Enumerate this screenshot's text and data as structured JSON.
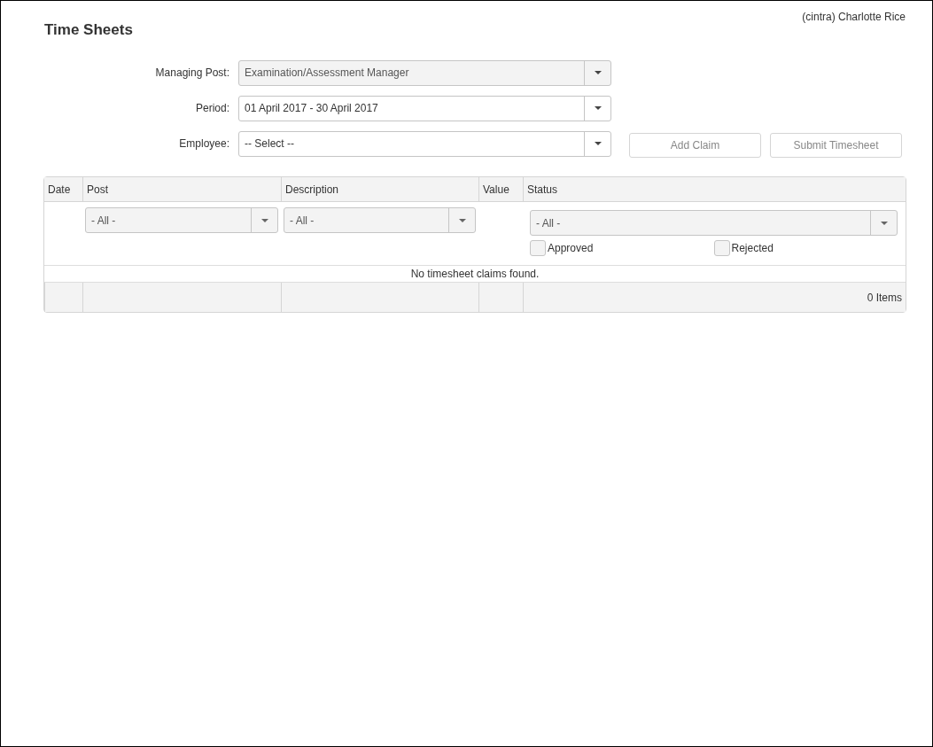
{
  "user": "(cintra) Charlotte Rice",
  "title": "Time Sheets",
  "form": [
    {
      "label": "Managing Post:",
      "value": "Examination/Assessment Manager",
      "disabled": true
    },
    {
      "label": "Period:",
      "value": "01 April 2017 - 30 April 2017",
      "disabled": false
    },
    {
      "label": "Employee:",
      "value": "-- Select --",
      "disabled": false
    }
  ],
  "buttons": [
    {
      "label": "Add Claim",
      "disabled": true
    },
    {
      "label": "Submit Timesheet",
      "disabled": true
    }
  ],
  "table": {
    "columns": [
      "Date",
      "Post",
      "Description",
      "Value",
      "Status"
    ],
    "filters": {
      "post": "- All -",
      "description": "- All -",
      "status": "- All -",
      "status_options": [
        {
          "label": "Approved",
          "checked": false
        },
        {
          "label": "Rejected",
          "checked": false
        }
      ]
    },
    "empty_message": "No timesheet claims found.",
    "footer": "0 Items"
  }
}
